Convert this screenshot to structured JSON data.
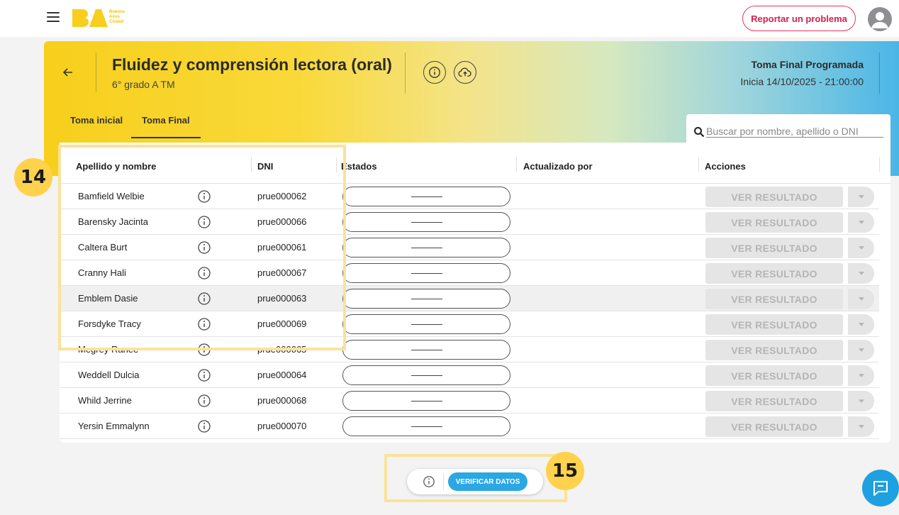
{
  "header": {
    "logo_text": [
      "Buenos",
      "Aires",
      "Ciudad"
    ],
    "report_label": "Reportar un problema"
  },
  "hero": {
    "title": "Fluidez y comprensión lectora (oral)",
    "subtitle": "6° grado A TM",
    "toma_title": "Toma Final Programada",
    "toma_date": "Inicia 14/10/2025 - 21:00:00"
  },
  "tabs": [
    {
      "label": "Toma inicial",
      "active": false
    },
    {
      "label": "Toma Final",
      "active": true
    }
  ],
  "search": {
    "placeholder": "Buscar por nombre, apellido o DNI"
  },
  "table": {
    "columns": [
      "Apellido y nombre",
      "DNI",
      "Estados",
      "Actualizado por",
      "Acciones"
    ],
    "rows": [
      {
        "name": "Bamfield Welbie",
        "dni": "prue000062"
      },
      {
        "name": "Barensky Jacinta",
        "dni": "prue000066"
      },
      {
        "name": "Caltera Burt",
        "dni": "prue000061"
      },
      {
        "name": "Cranny Hali",
        "dni": "prue000067"
      },
      {
        "name": "Emblem Dasie",
        "dni": "prue000063"
      },
      {
        "name": "Forsdyke Tracy",
        "dni": "prue000069"
      },
      {
        "name": "Megrey Ranee",
        "dni": "prue000065"
      },
      {
        "name": "Weddell Dulcia",
        "dni": "prue000064"
      },
      {
        "name": "Whild Jerrine",
        "dni": "prue000068"
      },
      {
        "name": "Yersin Emmalynn",
        "dni": "prue000070"
      }
    ],
    "action_label": "VER RESULTADO"
  },
  "annotations": {
    "badge_14": "14",
    "badge_15": "15"
  },
  "footer": {
    "verify_label": "VERIFICAR DATOS"
  },
  "colors": {
    "accent_blue": "#2aa7e4",
    "report_red": "#d6204f",
    "annotation_yellow": "#ffd24d"
  }
}
